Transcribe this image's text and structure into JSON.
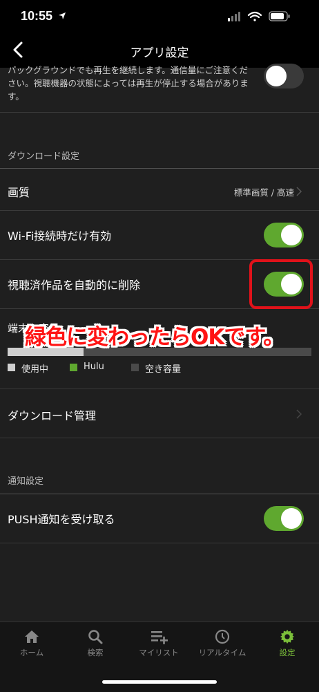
{
  "status_bar": {
    "time": "10:55"
  },
  "header": {
    "title": "アプリ設定"
  },
  "background_play": {
    "description": "バックグラウンドでも再生を継続します。通信量にご注意ください。視聴機器の状態によっては再生が停止する場合があります。",
    "enabled": false
  },
  "download_section": {
    "heading": "ダウンロード設定",
    "quality_label": "画質",
    "quality_value": "標準画質 / 高速",
    "wifi_only_label": "Wi-Fi接続時だけ有効",
    "wifi_only_enabled": true,
    "auto_delete_label": "視聴済作品を自動的に削除",
    "auto_delete_enabled": true,
    "storage_label": "端末の容量",
    "storage_legend": {
      "used": "使用中",
      "hulu": "Hulu",
      "free": "空き容量"
    },
    "storage_used_fraction": 0.25,
    "manage_label": "ダウンロード管理"
  },
  "notification_section": {
    "heading": "通知設定",
    "push_label": "PUSH通知を受け取る",
    "push_enabled": true
  },
  "annotation": {
    "text": "緑色に変わったらOKです。",
    "color": "#ff1414"
  },
  "tabs": [
    {
      "label": "ホーム",
      "icon": "home-icon"
    },
    {
      "label": "検索",
      "icon": "search-icon"
    },
    {
      "label": "マイリスト",
      "icon": "mylist-icon"
    },
    {
      "label": "リアルタイム",
      "icon": "clock-icon"
    },
    {
      "label": "設定",
      "icon": "gear-icon",
      "active": true
    }
  ],
  "colors": {
    "toggle_on": "#5fa82f",
    "accent": "#7bbf3a",
    "highlight": "#e0121a",
    "hulu_legend": "#5fa82f"
  }
}
